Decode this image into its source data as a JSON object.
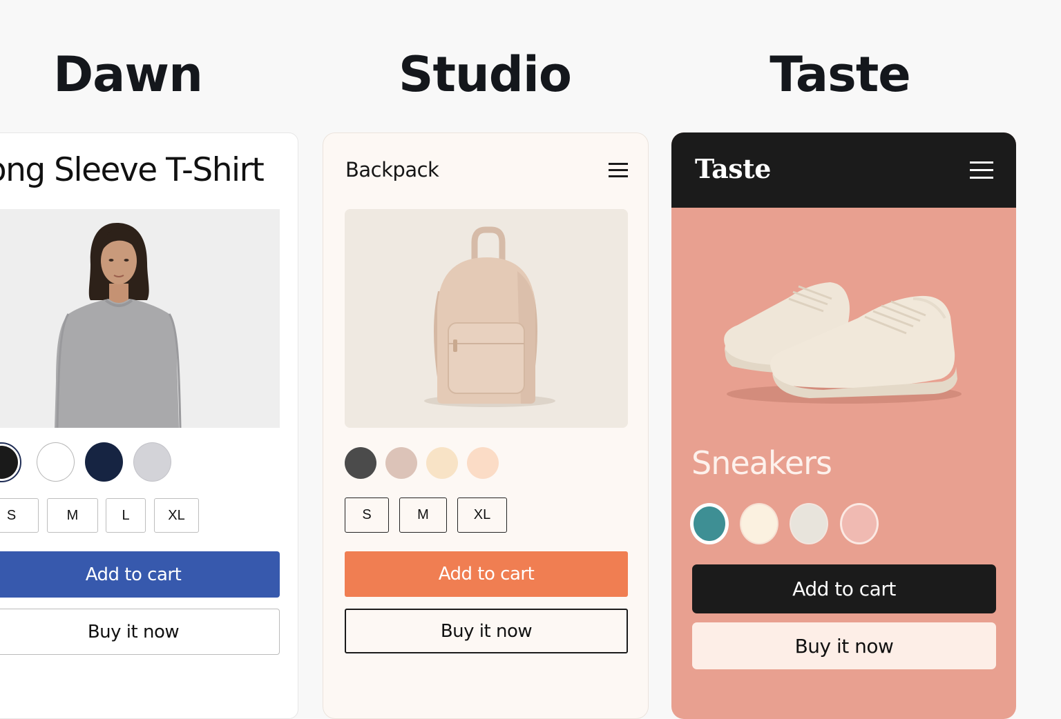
{
  "themes": {
    "dawn": {
      "heading": "Dawn",
      "product_title": "Long Sleeve T-Shirt",
      "image": "woman-in-gray-long-sleeve-shirt",
      "swatches": [
        {
          "name": "black",
          "color": "#1a1a1a",
          "selected": true
        },
        {
          "name": "white",
          "color": "#ffffff",
          "selected": false
        },
        {
          "name": "navy",
          "color": "#162442",
          "selected": false
        },
        {
          "name": "gray",
          "color": "#d3d3d8",
          "selected": false
        }
      ],
      "sizes": [
        "S",
        "M",
        "L",
        "XL"
      ],
      "add_to_cart": "Add to cart",
      "buy_now": "Buy it now",
      "accent": "#3759ad"
    },
    "studio": {
      "heading": "Studio",
      "product_title": "Backpack",
      "menu_icon": "hamburger-icon",
      "image": "beige-backpack",
      "swatches": [
        {
          "name": "charcoal",
          "color": "#4b4b4b"
        },
        {
          "name": "taupe",
          "color": "#dcc3b8"
        },
        {
          "name": "cream",
          "color": "#f8e3c6"
        },
        {
          "name": "peach",
          "color": "#fbdcc6"
        }
      ],
      "sizes": [
        "S",
        "M",
        "XL"
      ],
      "add_to_cart": "Add to cart",
      "buy_now": "Buy it now",
      "accent": "#f07e52"
    },
    "taste": {
      "heading": "Taste",
      "brand": "Taste",
      "menu_icon": "hamburger-icon",
      "product_title": "Sneakers",
      "image": "cream-sneakers",
      "swatches": [
        {
          "name": "teal",
          "color": "#3e8f94",
          "selected": true
        },
        {
          "name": "cream",
          "color": "#fbf1e0"
        },
        {
          "name": "bone",
          "color": "#e8e4dc"
        },
        {
          "name": "blush",
          "color": "#f0bab2"
        }
      ],
      "add_to_cart": "Add to cart",
      "buy_now": "Buy it now",
      "accent": "#e8a090"
    }
  }
}
